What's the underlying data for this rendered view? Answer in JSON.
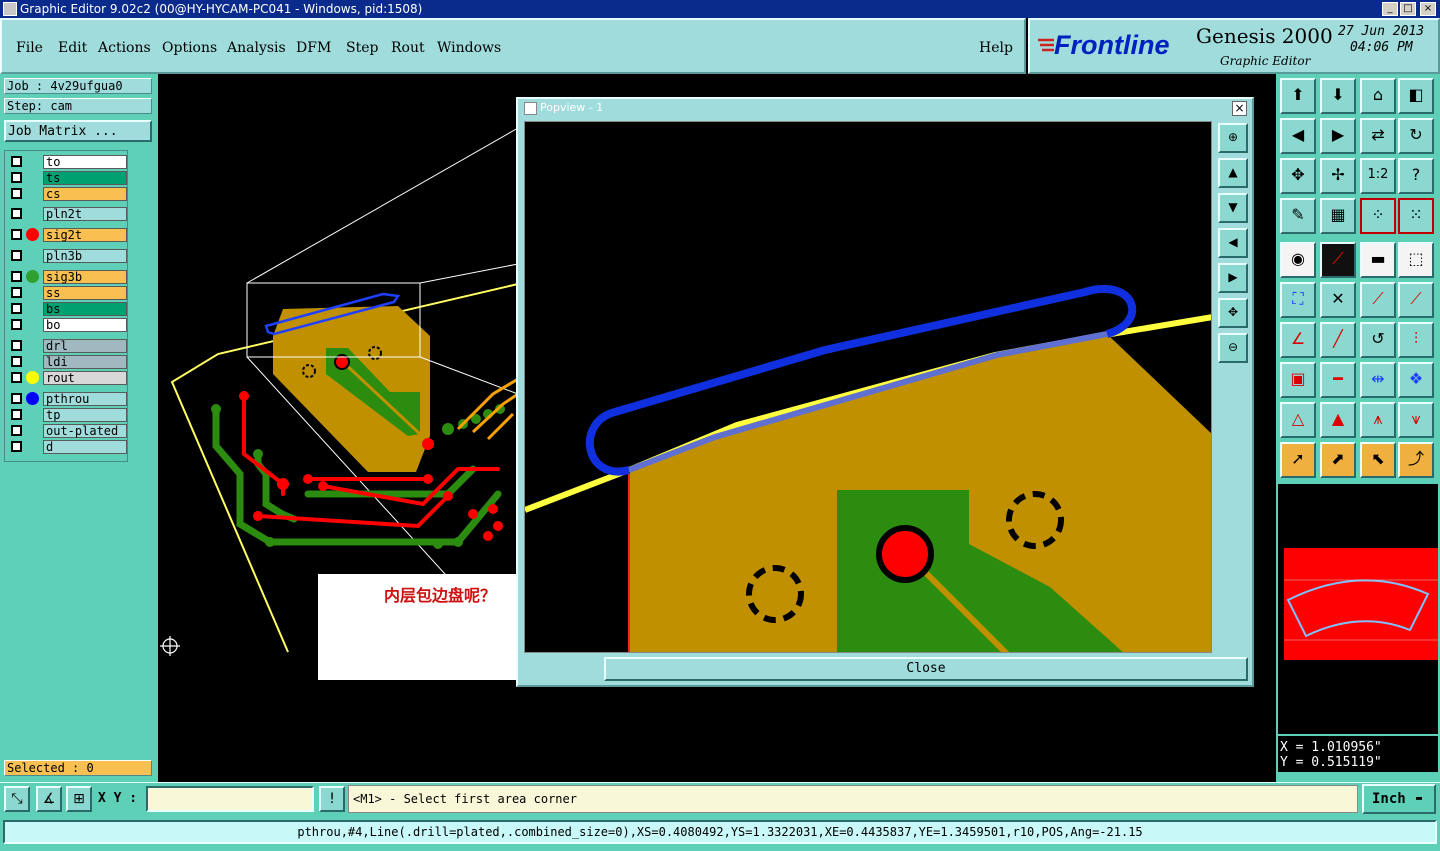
{
  "window": {
    "title": "Graphic Editor 9.02c2 (00@HY-HYCAM-PC041 - Windows, pid:1508)"
  },
  "menu": {
    "items": [
      "File",
      "Edit",
      "Actions",
      "Options",
      "Analysis",
      "DFM",
      "Step",
      "Rout",
      "Windows"
    ],
    "help": "Help"
  },
  "brand": {
    "logo": "Frontline",
    "product": "Genesis 2000",
    "subtitle": "Graphic Editor",
    "date": "27 Jun 2013",
    "time": "04:06 PM"
  },
  "job": {
    "job_line": "Job : 4v29ufgua0",
    "step_line": "Step: cam",
    "matrix_button": "Job Matrix ..."
  },
  "layers": [
    {
      "name": "to",
      "bg": "#ffffff",
      "dot": ""
    },
    {
      "name": "ts",
      "bg": "#00a070",
      "dot": ""
    },
    {
      "name": "cs",
      "bg": "#f8c050",
      "dot": ""
    },
    {
      "name": "pln2t",
      "bg": "#a0dcdc",
      "dot": ""
    },
    {
      "name": "sig2t",
      "bg": "#f8c050",
      "dot": "#ff0000"
    },
    {
      "name": "pln3b",
      "bg": "#a0dcdc",
      "dot": ""
    },
    {
      "name": "sig3b",
      "bg": "#f8c050",
      "dot": "#30a030"
    },
    {
      "name": "ss",
      "bg": "#f8c050",
      "dot": ""
    },
    {
      "name": "bs",
      "bg": "#00a070",
      "dot": ""
    },
    {
      "name": "bo",
      "bg": "#ffffff",
      "dot": ""
    },
    {
      "name": "drl",
      "bg": "#a0b8c0",
      "dot": ""
    },
    {
      "name": "ldi",
      "bg": "#a0b8c0",
      "dot": ""
    },
    {
      "name": "rout",
      "bg": "#d8d8d8",
      "dot": "#ffff00"
    },
    {
      "name": "pthrou",
      "bg": "#a0dcdc",
      "dot": "#0000ff"
    },
    {
      "name": "tp",
      "bg": "#a0dcdc",
      "dot": ""
    },
    {
      "name": "out-plated",
      "bg": "#a0dcdc",
      "dot": ""
    },
    {
      "name": "d",
      "bg": "#a0dcdc",
      "dot": ""
    }
  ],
  "selected": "Selected : 0",
  "popup": {
    "title": "Popview - 1",
    "close_label": "Close"
  },
  "annotation": {
    "text": "内层包边盘呢？"
  },
  "coords": {
    "x": "X = 1.010956\"",
    "y": "Y = 0.515119\""
  },
  "status": {
    "xy_label": "X Y :",
    "xy_value": "",
    "prompt": "<M1> - Select first area corner",
    "units": "Inch"
  },
  "info_line": "pthrou,#4,Line(.drill=plated,.combined_size=0),XS=0.4080492,YS=1.3322031,XE=0.4435837,YE=1.3459501,r10,POS,Ang=-21.15",
  "tool_labels": {
    "ratio": "1:2",
    "help": "?"
  },
  "colors": {
    "panel": "#5fd0b8",
    "menu": "#a0dcdc",
    "titlebar": "#0a2a8c",
    "copper": "#c09000",
    "signal_green": "#2c8c10",
    "trace_red": "#ff0000",
    "rout_blue": "#1030e0",
    "rout_yellow": "#ffff40"
  }
}
